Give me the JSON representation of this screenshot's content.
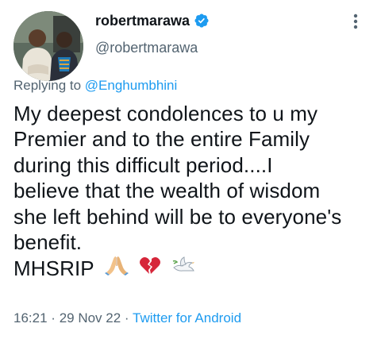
{
  "author": {
    "display_name": "robertmarawa",
    "handle": "@robertmarawa"
  },
  "reply": {
    "prefix": "Replying to",
    "mention": "@Enghumbhini"
  },
  "body": {
    "lines": [
      "My deepest condolences to u my",
      "Premier and to the entire Family",
      "during this difficult period....I",
      "believe that the wealth of wisdom",
      "she left behind will be to everyone's",
      "benefit."
    ],
    "last_line": "MHSRIP",
    "emojis": [
      "folded-hands",
      "broken-heart",
      "dove"
    ]
  },
  "meta": {
    "time": "16:21",
    "separator": "·",
    "date": "29 Nov 22",
    "source": "Twitter for Android"
  },
  "colors": {
    "text": "#0f1419",
    "secondary": "#536471",
    "accent": "#1d9bf0"
  }
}
